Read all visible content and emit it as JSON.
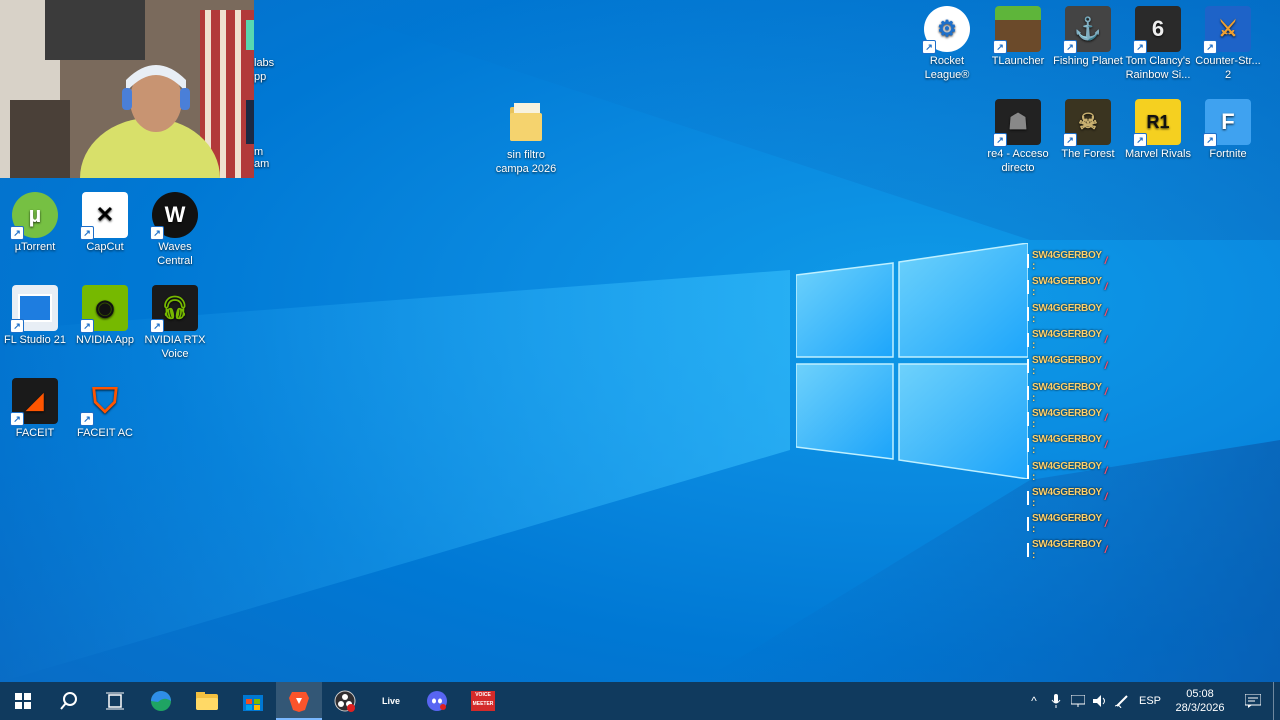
{
  "desktop": {
    "left_icons": [
      {
        "name": "utorrent",
        "label": "µTorrent"
      },
      {
        "name": "capcut",
        "label": "CapCut"
      },
      {
        "name": "waves-central",
        "label": "Waves Central"
      },
      {
        "name": "fl-studio",
        "label": "FL Studio 21"
      },
      {
        "name": "nvidia-app",
        "label": "NVIDIA App"
      },
      {
        "name": "nvidia-rtx-voice",
        "label": "NVIDIA RTX Voice"
      },
      {
        "name": "faceit",
        "label": "FACEIT"
      },
      {
        "name": "faceit-ac",
        "label": "FACEIT AC"
      }
    ],
    "partial_labels": [
      "labs",
      "pp",
      "m",
      "am"
    ],
    "folder": {
      "label": "sin filtro campa 2026"
    },
    "right_icons": [
      {
        "name": "rocket-league",
        "label": "Rocket League®"
      },
      {
        "name": "tlauncher",
        "label": "TLauncher"
      },
      {
        "name": "fishing-planet",
        "label": "Fishing Planet"
      },
      {
        "name": "rainbow-six",
        "label": "Tom Clancy's Rainbow Si..."
      },
      {
        "name": "counter-strike",
        "label": "Counter-Str... 2"
      },
      {
        "name": "re4",
        "label": "re4 - Acceso directo"
      },
      {
        "name": "the-forest",
        "label": "The Forest"
      },
      {
        "name": "marvel-rivals",
        "label": "Marvel Rivals"
      },
      {
        "name": "fortnite",
        "label": "Fortnite"
      }
    ],
    "watermark_text": "SW4GGERBOY :",
    "watermark_repeat": 12
  },
  "taskbar": {
    "apps": [
      "start-button",
      "search-button",
      "task-view-button",
      "edge",
      "file-explorer",
      "microsoft-store",
      "brave",
      "obs",
      "live",
      "discord",
      "voicemeeter"
    ],
    "live_label": "Live",
    "voicemeeter_label": "VOICE MEETER",
    "language": "ESP",
    "time": "05:08",
    "date": "28/3/2026"
  },
  "colors": {
    "desktop_blue": "#0078d4",
    "taskbar": "#103a5e",
    "utorrent": "#76c043",
    "nvidia": "#76b900",
    "faceit": "#ff5500",
    "brave": "#fb542b",
    "discord": "#5865f2"
  }
}
